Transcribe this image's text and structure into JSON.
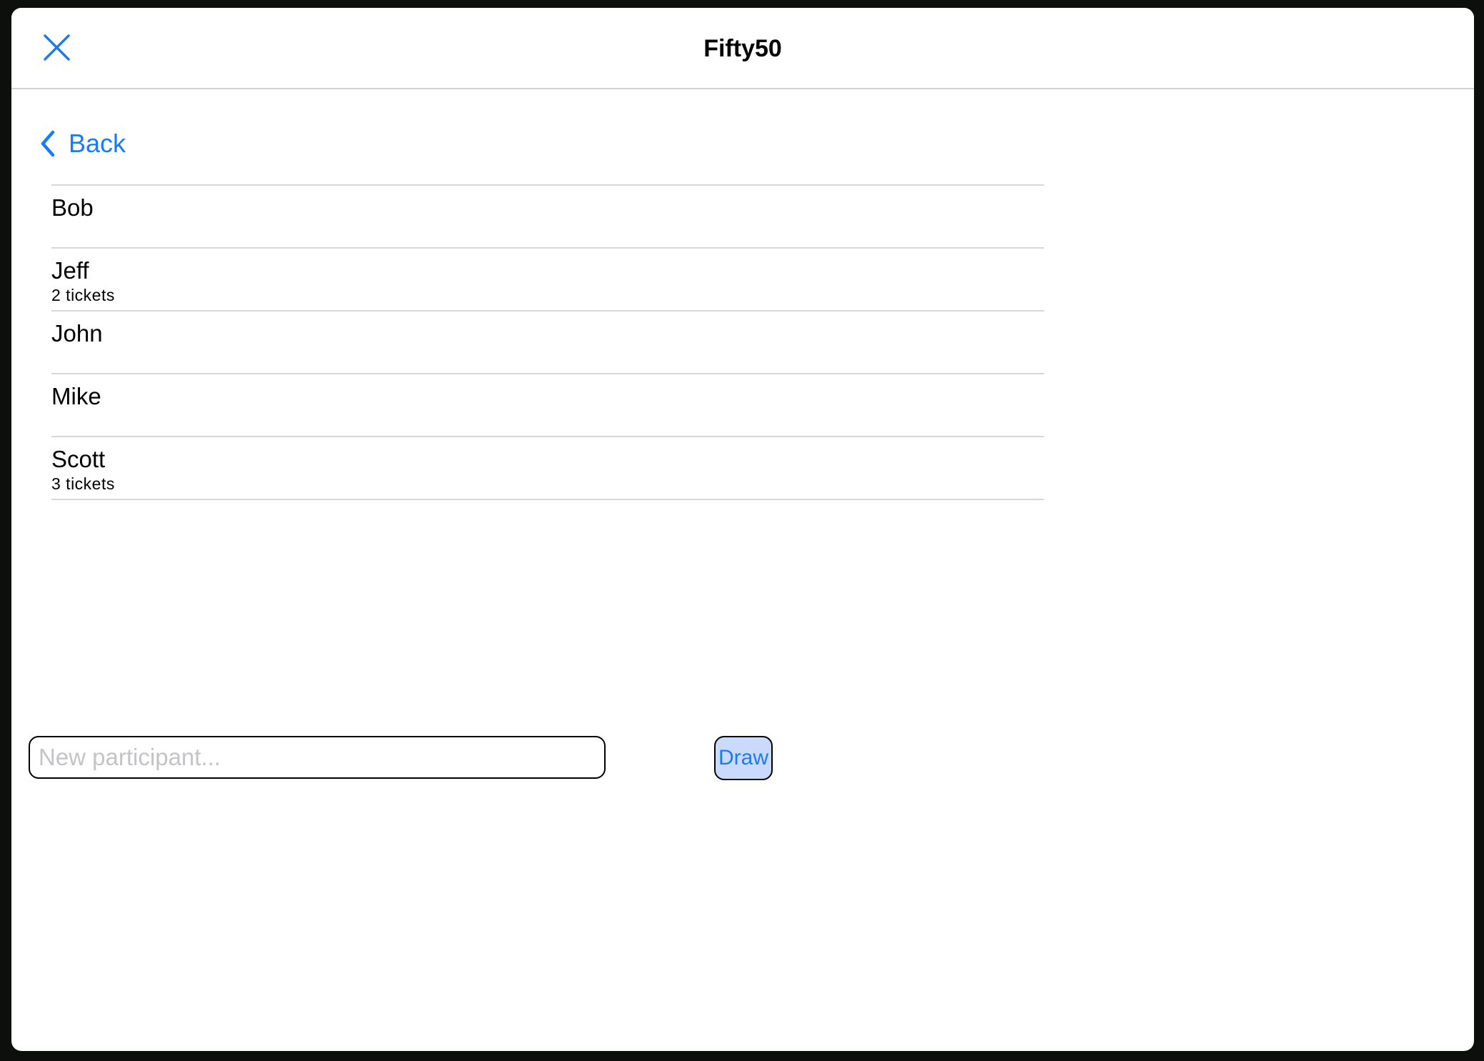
{
  "app": {
    "title": "Fifty50"
  },
  "nav": {
    "close_icon": "close-icon",
    "back_icon": "chevron-left-icon",
    "back_label": "Back"
  },
  "participants": [
    {
      "name": "Bob",
      "tickets": ""
    },
    {
      "name": "Jeff",
      "tickets": "2 tickets"
    },
    {
      "name": "John",
      "tickets": ""
    },
    {
      "name": "Mike",
      "tickets": ""
    },
    {
      "name": "Scott",
      "tickets": "3 tickets"
    }
  ],
  "new_participant": {
    "value": "",
    "placeholder": "New participant..."
  },
  "draw_button": {
    "label": "Draw"
  },
  "colors": {
    "accent": "#1a7cf2",
    "draw_button_bg": "#c9dafc",
    "separator": "#d8d8da"
  }
}
